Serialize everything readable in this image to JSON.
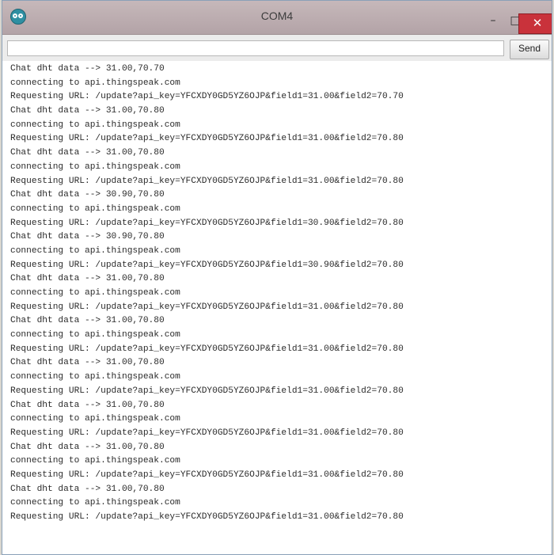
{
  "window": {
    "title": "COM4",
    "minimize_glyph": "–",
    "maximize_glyph": "□",
    "close_glyph": "✕"
  },
  "toolbar": {
    "input_value": "",
    "send_label": "Send"
  },
  "serial": {
    "lines": [
      "Chat dht data --> 31.00,70.70",
      "connecting to api.thingspeak.com",
      "Requesting URL: /update?api_key=YFCXDY0GD5YZ6OJP&field1=31.00&field2=70.70",
      "Chat dht data --> 31.00,70.80",
      "connecting to api.thingspeak.com",
      "Requesting URL: /update?api_key=YFCXDY0GD5YZ6OJP&field1=31.00&field2=70.80",
      "Chat dht data --> 31.00,70.80",
      "connecting to api.thingspeak.com",
      "Requesting URL: /update?api_key=YFCXDY0GD5YZ6OJP&field1=31.00&field2=70.80",
      "Chat dht data --> 30.90,70.80",
      "connecting to api.thingspeak.com",
      "Requesting URL: /update?api_key=YFCXDY0GD5YZ6OJP&field1=30.90&field2=70.80",
      "Chat dht data --> 30.90,70.80",
      "connecting to api.thingspeak.com",
      "Requesting URL: /update?api_key=YFCXDY0GD5YZ6OJP&field1=30.90&field2=70.80",
      "Chat dht data --> 31.00,70.80",
      "connecting to api.thingspeak.com",
      "Requesting URL: /update?api_key=YFCXDY0GD5YZ6OJP&field1=31.00&field2=70.80",
      "Chat dht data --> 31.00,70.80",
      "connecting to api.thingspeak.com",
      "Requesting URL: /update?api_key=YFCXDY0GD5YZ6OJP&field1=31.00&field2=70.80",
      "Chat dht data --> 31.00,70.80",
      "connecting to api.thingspeak.com",
      "Requesting URL: /update?api_key=YFCXDY0GD5YZ6OJP&field1=31.00&field2=70.80",
      "Chat dht data --> 31.00,70.80",
      "connecting to api.thingspeak.com",
      "Requesting URL: /update?api_key=YFCXDY0GD5YZ6OJP&field1=31.00&field2=70.80",
      "Chat dht data --> 31.00,70.80",
      "connecting to api.thingspeak.com",
      "Requesting URL: /update?api_key=YFCXDY0GD5YZ6OJP&field1=31.00&field2=70.80",
      "Chat dht data --> 31.00,70.80",
      "connecting to api.thingspeak.com",
      "Requesting URL: /update?api_key=YFCXDY0GD5YZ6OJP&field1=31.00&field2=70.80"
    ]
  },
  "colors": {
    "titlebar": "#b9abae",
    "close_button": "#c9323b",
    "text": "#2b2b2b"
  },
  "icons": {
    "app": "arduino-icon"
  }
}
